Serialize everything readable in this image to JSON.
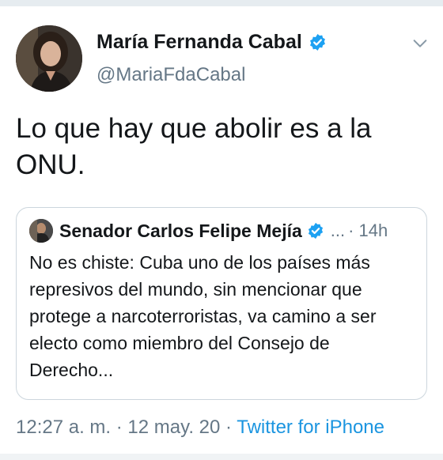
{
  "tweet": {
    "display_name": "María Fernanda Cabal",
    "handle": "@MariaFdaCabal",
    "text": "Lo que hay que abolir es a la ONU.",
    "timestamp": "12:27 a. m. · 12 may. 20 · ",
    "source": "Twitter for iPhone"
  },
  "quoted": {
    "display_name": "Senador Carlos Felipe Mejía",
    "ellipsis": "...",
    "time": "· 14h",
    "text": "No es chiste: Cuba uno de los países más represivos del mundo, sin mencionar que protege a narcoterroristas, va camino a ser electo como miembro del Consejo de Derecho..."
  },
  "colors": {
    "accent": "#1da1f2",
    "link": "#1b95e0",
    "secondary_text": "#657786",
    "border": "#ccd6dd"
  },
  "icons": {
    "verified": "verified-badge-icon",
    "more": "chevron-down-icon"
  }
}
